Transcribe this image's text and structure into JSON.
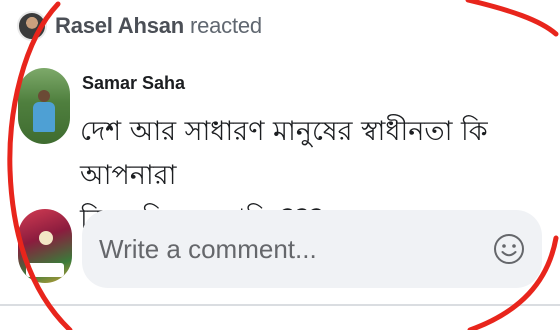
{
  "reaction": {
    "user_name": "Rasel Ahsan",
    "action": "reacted"
  },
  "comment": {
    "author": "Samar Saha",
    "line1": "দেশ আর সাধারণ মানুষের স্বাধীনতা কি আপনারা",
    "line2": "কিনে নিলেন নাকি ???"
  },
  "composer": {
    "placeholder": "Write a comment...",
    "emoji_icon": "smiley-icon"
  },
  "colors": {
    "annotation_circle": "#e8251c",
    "composer_bg": "#f0f2f5",
    "secondary_text": "#65676b"
  }
}
